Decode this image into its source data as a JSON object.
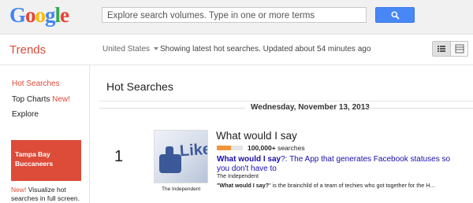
{
  "colors": {
    "brand_red": "#dd4b39",
    "link_blue": "#1a0dab",
    "search_button": "#4887f6",
    "bar_orange": "#f0953b",
    "logo": [
      "#4285f4",
      "#ea4335",
      "#fbbc05",
      "#4285f4",
      "#34a853",
      "#ea4335"
    ]
  },
  "header": {
    "logo_letters": [
      "G",
      "o",
      "o",
      "g",
      "l",
      "e"
    ],
    "search_placeholder": "Explore search volumes. Type in one or more terms",
    "search_icon": "search-icon"
  },
  "subheader": {
    "title": "Trends",
    "country": "United States",
    "status": "Showing latest hot searches. Updated about 54 minutes ago",
    "view_icons": [
      "list-view-icon",
      "grid-view-icon"
    ]
  },
  "sidebar": {
    "hot_searches": "Hot Searches",
    "top_charts": "Top Charts",
    "top_charts_badge": "New!",
    "explore": "Explore",
    "promo_line1": "Tampa Bay",
    "promo_line2": "Buccaneers",
    "promo_badge": "New!",
    "promo_caption": "Visualize hot searches in full screen."
  },
  "main": {
    "title": "Hot Searches",
    "date": "Wednesday, November 13, 2013",
    "items": [
      {
        "rank": "1",
        "title": "What would I say",
        "volume": "100,000+",
        "volume_suffix": "searches",
        "volume_fraction": 0.55,
        "thumb_text": "Like",
        "thumb_caption": "The Independent",
        "article_bold": "What would I say",
        "article_rest": "?: The App that generates Facebook statuses so you don't have to",
        "source": "The Independent",
        "snippet_bold": "\"What would I say?",
        "snippet_rest": "\" is the brainchild of a team of techies who got together for the H..."
      }
    ]
  }
}
